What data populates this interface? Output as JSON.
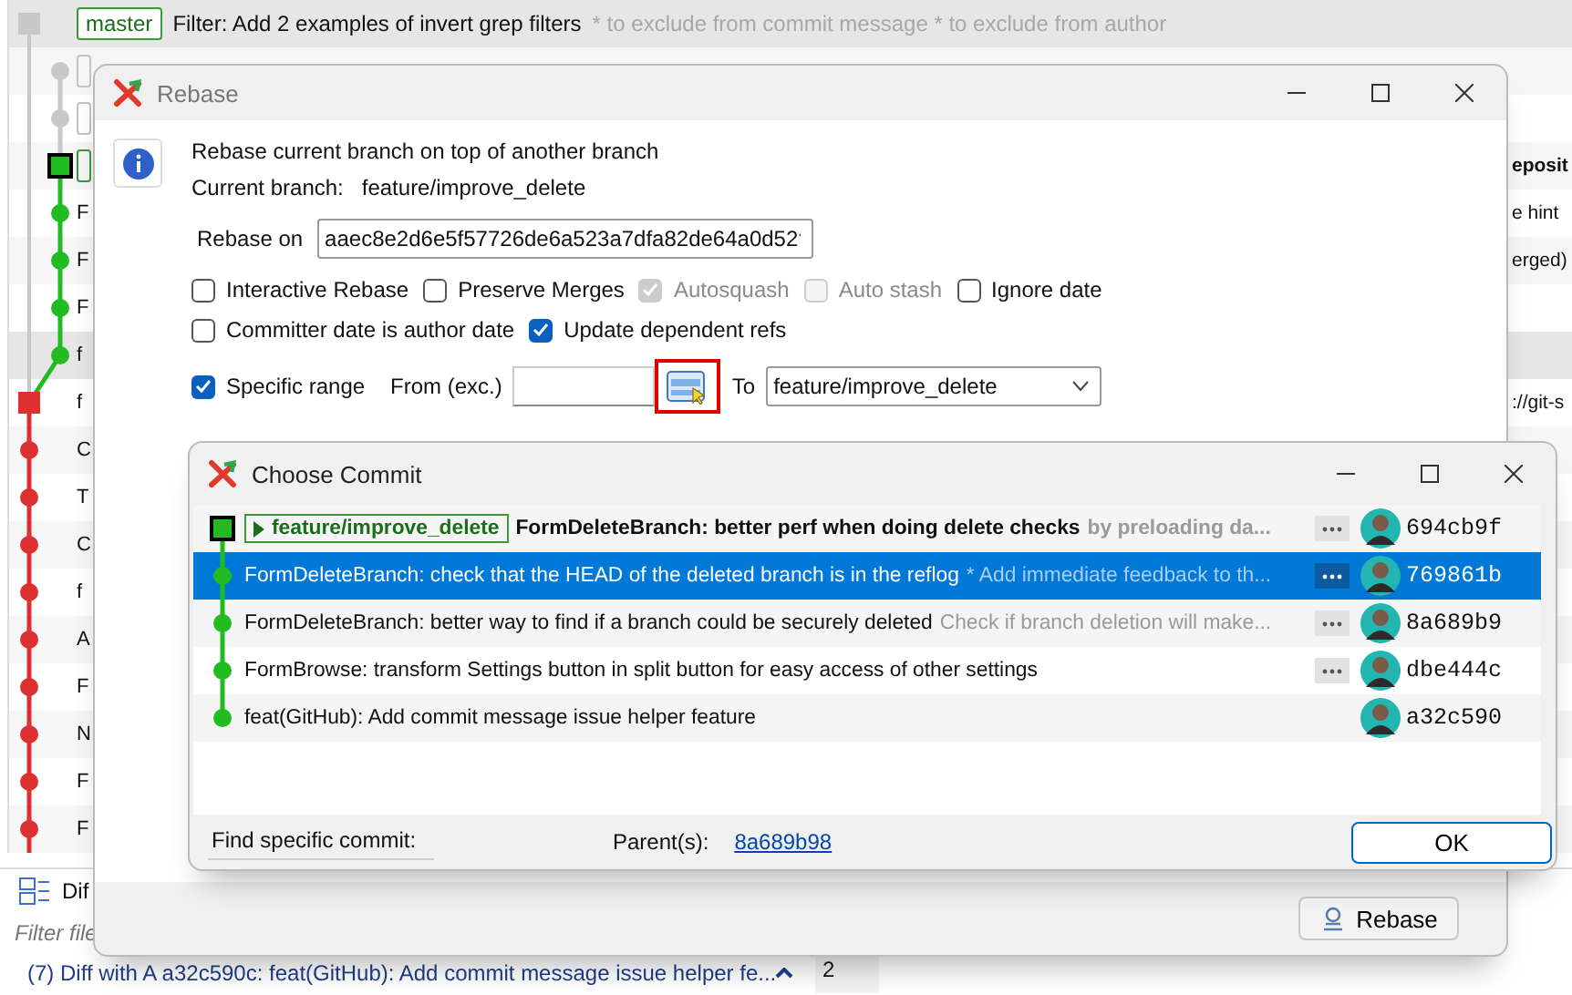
{
  "background": {
    "rows": [
      {
        "kind": "head",
        "highlighted": true,
        "branch": "master",
        "subject": "Filter: Add 2 examples of invert grep filters",
        "detail": "* to exclude from commit message * to exclude from author"
      },
      {
        "kind": "gray",
        "highlighted": false,
        "color": "#c4c4c4"
      },
      {
        "kind": "gray",
        "highlighted": false,
        "color": "#c4c4c4"
      },
      {
        "kind": "current",
        "highlighted": false,
        "color": "#3a9a3a",
        "right": "eposit",
        "right_bold": true
      },
      {
        "kind": "green",
        "highlighted": false,
        "letter": "F",
        "right": "e hint",
        "right_bold": false
      },
      {
        "kind": "green",
        "highlighted": false,
        "letter": "F",
        "right": "erged)",
        "right_bold": false
      },
      {
        "kind": "green",
        "highlighted": false,
        "letter": "F"
      },
      {
        "kind": "green",
        "highlighted": true,
        "letter": "f"
      },
      {
        "kind": "base",
        "highlighted": false,
        "letter": "f",
        "right": "://git-s",
        "right_bold": false
      },
      {
        "kind": "red",
        "highlighted": false,
        "letter": "C"
      },
      {
        "kind": "red",
        "highlighted": false,
        "letter": "T"
      },
      {
        "kind": "red",
        "highlighted": false,
        "letter": "C"
      },
      {
        "kind": "red",
        "highlighted": false,
        "letter": "f"
      },
      {
        "kind": "red",
        "highlighted": false,
        "letter": "A"
      },
      {
        "kind": "red",
        "highlighted": false,
        "letter": "F"
      },
      {
        "kind": "red",
        "highlighted": false,
        "letter": "N"
      },
      {
        "kind": "red",
        "highlighted": false,
        "letter": "F"
      },
      {
        "kind": "red",
        "highlighted": false,
        "letter": "F"
      }
    ],
    "diff_panel": {
      "tab": "Dif",
      "placeholder": "Filter file",
      "line": "(7) Diff with A a32c590c: feat(GitHub): Add commit message issue helper fe...",
      "count": "2"
    }
  },
  "rebase_dialog": {
    "title": "Rebase",
    "heading": "Rebase current branch on top of another branch",
    "current_branch_label": "Current branch:",
    "current_branch": "feature/improve_delete",
    "rebase_on_label": "Rebase on",
    "rebase_on": "aaec8e2d6e5f57726de6a523a7dfa82de64a0d52",
    "option_rows": [
      [
        {
          "label": "Interactive Rebase",
          "checked": false,
          "disabled": false
        },
        {
          "label": "Preserve Merges",
          "checked": false,
          "disabled": false
        },
        {
          "label": "Autosquash",
          "checked": true,
          "disabled": true
        },
        {
          "label": "Auto stash",
          "checked": false,
          "disabled": true
        },
        {
          "label": "Ignore date",
          "checked": false,
          "disabled": false
        }
      ],
      [
        {
          "label": "Committer date is author date",
          "checked": false,
          "disabled": false
        },
        {
          "label": "Update dependent refs",
          "checked": true,
          "disabled": false
        }
      ]
    ],
    "specific_range": {
      "label": "Specific range",
      "checked": true
    },
    "from_label": "From (exc.)",
    "to_label": "To",
    "to_value": "feature/improve_delete",
    "submit": "Rebase"
  },
  "choose_commit": {
    "title": "Choose Commit",
    "commits": [
      {
        "kind": "current",
        "selected": false,
        "branch": "feature/improve_delete",
        "subject": "FormDeleteBranch: better perf when doing delete checks",
        "detail": "by preloading da...",
        "has_more": true,
        "hash": "694cb9f"
      },
      {
        "kind": "green",
        "selected": true,
        "subject": "FormDeleteBranch: check that the HEAD of the deleted branch is in the reflog",
        "detail": "* Add immediate feedback to th...",
        "has_more": true,
        "hash": "769861b"
      },
      {
        "kind": "green",
        "selected": false,
        "subject": "FormDeleteBranch: better way to find if a branch could be securely deleted",
        "detail": "Check if branch deletion will make...",
        "has_more": true,
        "hash": "8a689b9"
      },
      {
        "kind": "green",
        "selected": false,
        "subject": "FormBrowse: transform Settings button in split button for easy access of other settings",
        "has_more": true,
        "hash": "dbe444c"
      },
      {
        "kind": "green",
        "selected": false,
        "subject": "feat(GitHub): Add commit message issue helper feature",
        "has_more": false,
        "hash": "a32c590"
      }
    ],
    "find_label": "Find specific commit:",
    "parents_label": "Parent(s):",
    "parent": "8a689b98",
    "ok": "OK"
  }
}
